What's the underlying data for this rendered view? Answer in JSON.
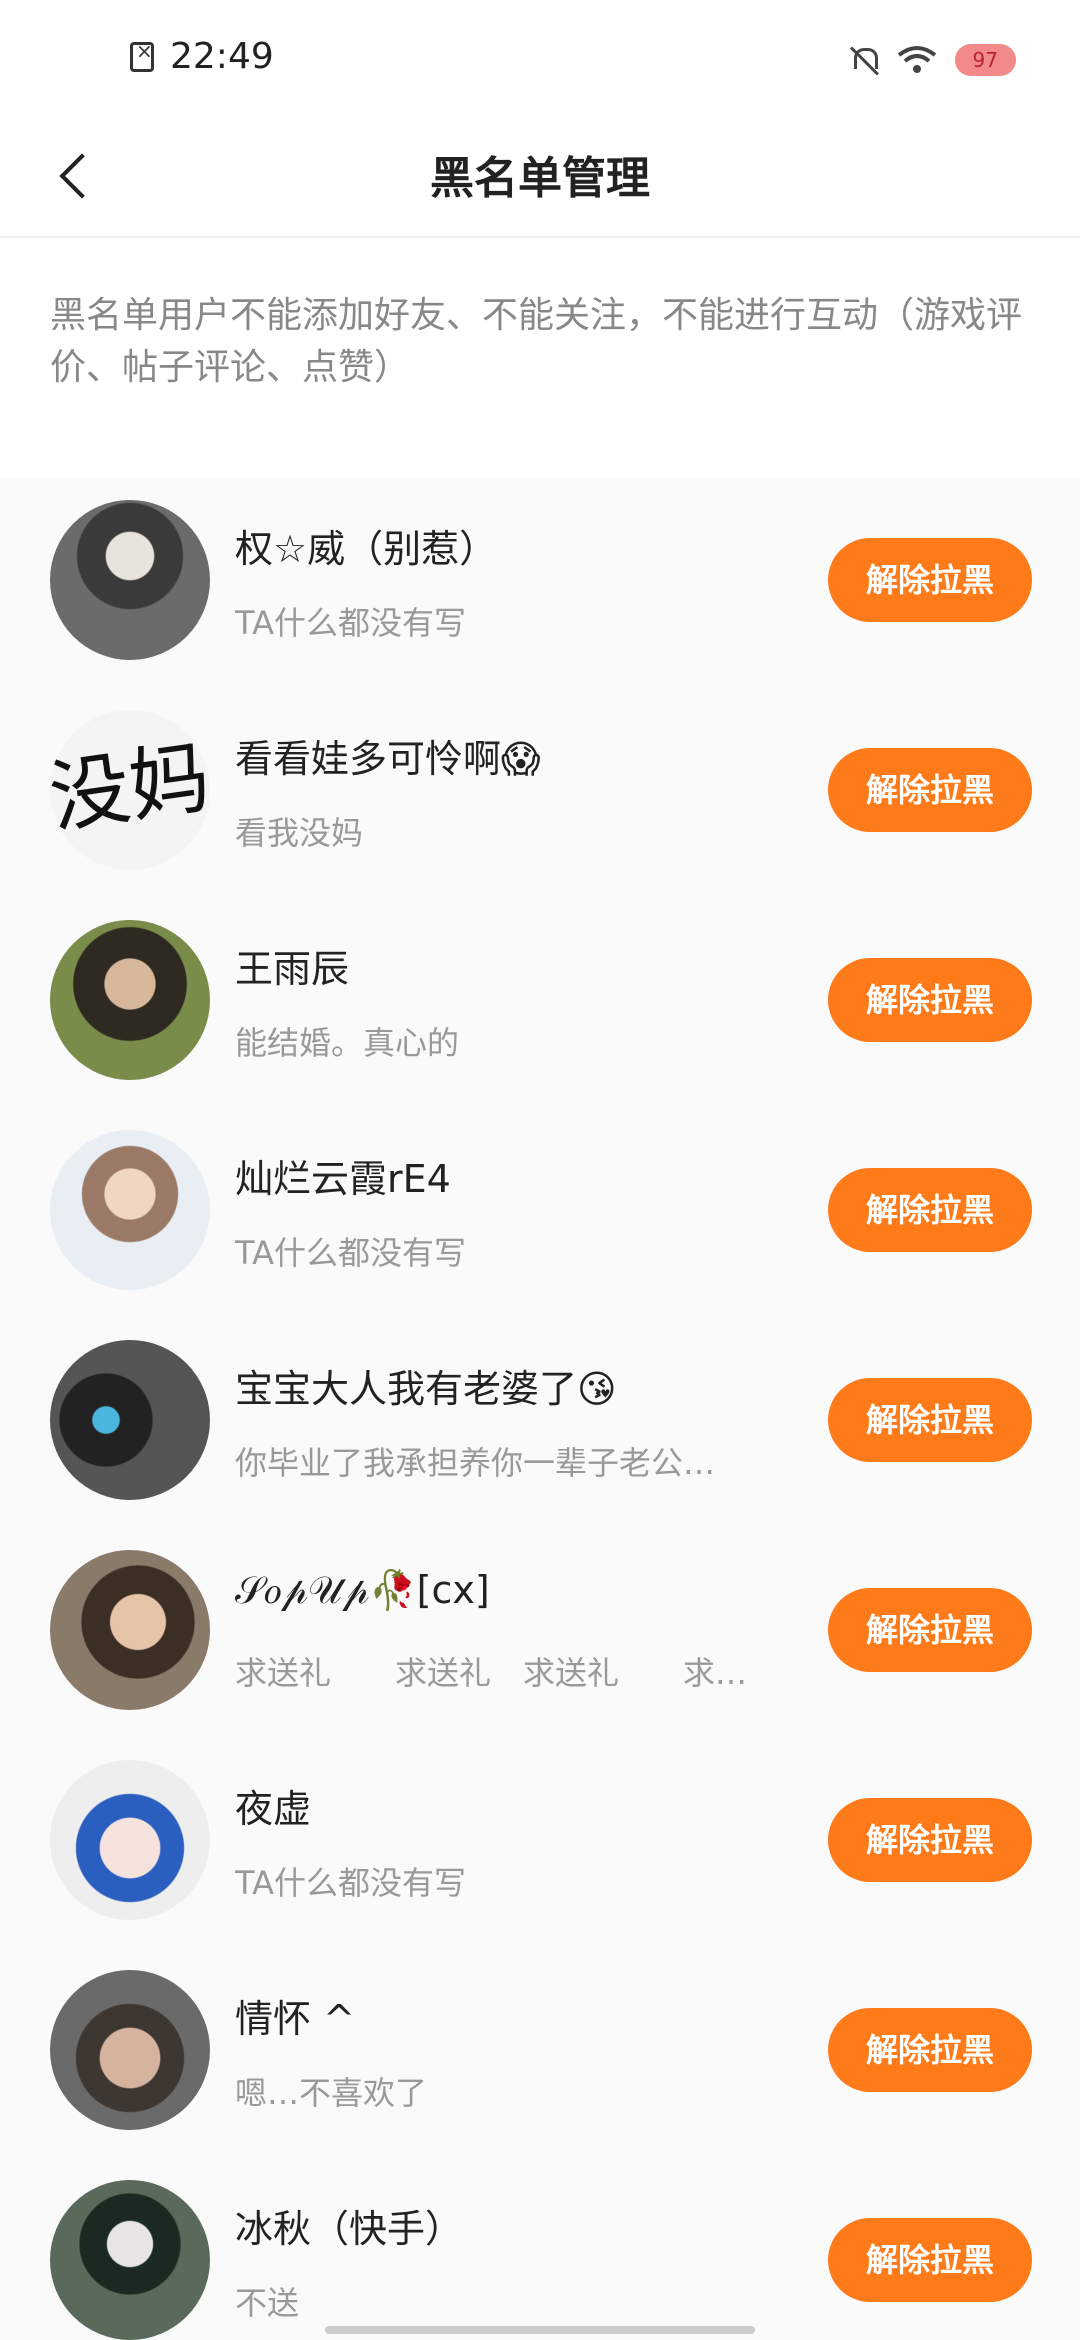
{
  "status_bar": {
    "time": "22:49",
    "battery": "97"
  },
  "header": {
    "title": "黑名单管理"
  },
  "description": "黑名单用户不能添加好友、不能关注，不能进行互动（游戏评价、帖子评论、点赞）",
  "colors": {
    "accent": "#ff7a18"
  },
  "users": [
    {
      "name": "权☆威（别惹）",
      "bio": "TA什么都没有写",
      "button_label": "解除拉黑"
    },
    {
      "name": "看看娃多可怜啊😱",
      "bio": "看我没妈",
      "button_label": "解除拉黑"
    },
    {
      "name": "王雨辰",
      "bio": "能结婚。真心的",
      "button_label": "解除拉黑"
    },
    {
      "name": "灿烂云霞rE4",
      "bio": "TA什么都没有写",
      "button_label": "解除拉黑"
    },
    {
      "name": "宝宝大人我有老婆了😘",
      "bio": "你毕业了我承担养你一辈子老公…",
      "button_label": "解除拉黑"
    },
    {
      "name": "𝒮𝑜𝓅𝒰𝓅🥀[cx]",
      "bio": "求送礼　　求送礼　求送礼　　求…",
      "button_label": "解除拉黑"
    },
    {
      "name": "夜虚",
      "bio": "TA什么都没有写",
      "button_label": "解除拉黑"
    },
    {
      "name": "情怀 ^",
      "bio": "嗯…不喜欢了",
      "button_label": "解除拉黑"
    },
    {
      "name": "冰秋（快手）",
      "bio": "不送",
      "button_label": "解除拉黑"
    }
  ]
}
